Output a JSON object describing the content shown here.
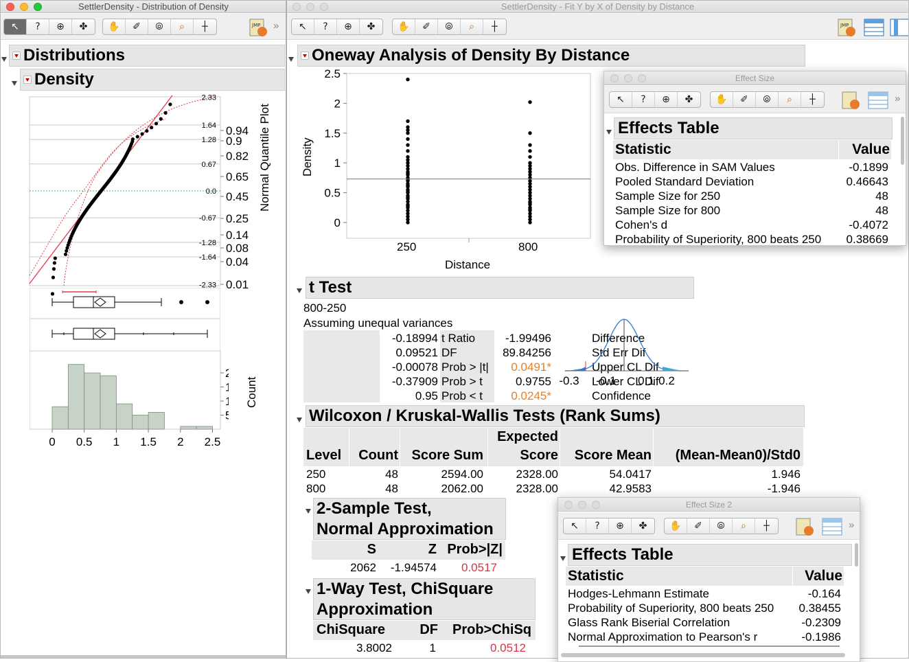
{
  "left_window": {
    "title": "SettlerDensity - Distribution of Density",
    "toolbar_icons": [
      "arrow-icon",
      "help-icon",
      "crosshair-icon",
      "move-icon",
      "hand-icon",
      "brush-icon",
      "lasso-icon",
      "magnifier-icon",
      "scale-icon"
    ],
    "distributions_title": "Distributions",
    "density_title": "Density",
    "quantile_axis_title": "Normal Quantile Plot",
    "quantile_ticks_z": [
      "2.33",
      "1.64",
      "1.28",
      "0.67",
      "0.0",
      "-0.67",
      "-1.28",
      "-1.64",
      "-2.33"
    ],
    "quantile_ticks_p": [
      "0.94",
      "0.9",
      "0.82",
      "0.65",
      "0.45",
      "0.25",
      "0.14",
      "0.08",
      "0.04",
      "0.01"
    ],
    "count_axis_title": "Count",
    "count_ticks": [
      "20",
      "15",
      "10",
      "5"
    ],
    "x_ticks": [
      "0",
      "0.5",
      "1",
      "1.5",
      "2",
      "2.5"
    ],
    "histogram_counts": [
      8,
      23,
      20,
      19,
      9,
      5,
      6,
      0,
      1,
      1
    ]
  },
  "right_window": {
    "title": "SettlerDensity - Fit Y by X of Density by Distance",
    "oneway_title": "Oneway Analysis of Density By Distance",
    "y_axis_label": "Density",
    "x_axis_label": "Distance",
    "y_ticks": [
      "2.5",
      "2",
      "1.5",
      "1",
      "0.5",
      "0"
    ],
    "x_ticks": [
      "250",
      "800"
    ],
    "grand_mean": 0.73
  },
  "ttest": {
    "title": "t Test",
    "comparison": "800-250",
    "assumption": "Assuming unequal variances",
    "rows": [
      {
        "label": "Difference",
        "value": "-0.18994",
        "stat": "t Ratio",
        "stat_value": "-1.99496",
        "highlight": false
      },
      {
        "label": "Std Err Dif",
        "value": "0.09521",
        "stat": "DF",
        "stat_value": "89.84256",
        "highlight": false
      },
      {
        "label": "Upper CL Dif",
        "value": "-0.00078",
        "stat": "Prob > |t|",
        "stat_value": "0.0491*",
        "highlight": true
      },
      {
        "label": "Lower CL Dif",
        "value": "-0.37909",
        "stat": "Prob > t",
        "stat_value": "0.9755",
        "highlight": false
      },
      {
        "label": "Confidence",
        "value": "0.95",
        "stat": "Prob < t",
        "stat_value": "0.0245*",
        "highlight": true
      }
    ],
    "dist_ticks": [
      "-0.3",
      "-0.1",
      "0.1",
      "0.2"
    ]
  },
  "wilcoxon": {
    "title": "Wilcoxon / Kruskal-Wallis Tests (Rank Sums)",
    "headers": {
      "level": "Level",
      "count": "Count",
      "score_sum": "Score Sum",
      "expected_1": "Expected",
      "expected_2": "Score",
      "score_mean": "Score Mean",
      "std0": "(Mean-Mean0)/Std0"
    },
    "rows": [
      {
        "level": "250",
        "count": "48",
        "score_sum": "2594.00",
        "expected": "2328.00",
        "score_mean": "54.0417",
        "std0": "1.946"
      },
      {
        "level": "800",
        "count": "48",
        "score_sum": "2062.00",
        "expected": "2328.00",
        "score_mean": "42.9583",
        "std0": "-1.946"
      }
    ]
  },
  "two_sample": {
    "title_1": "2-Sample Test,",
    "title_2": "Normal Approximation",
    "headers": {
      "s": "S",
      "z": "Z",
      "p": "Prob>|Z|"
    },
    "values": {
      "s": "2062",
      "z": "-1.94574",
      "p": "0.0517"
    }
  },
  "chisq": {
    "title_1": "1-Way Test, ChiSquare",
    "title_2": "Approximation",
    "headers": {
      "chi": "ChiSquare",
      "df": "DF",
      "p": "Prob>ChiSq"
    },
    "values": {
      "chi": "3.8002",
      "df": "1",
      "p": "0.0512"
    }
  },
  "effect_size": {
    "title": "Effect Size",
    "table_title": "Effects Table",
    "col_statistic": "Statistic",
    "col_value": "Value",
    "rows": [
      {
        "stat": "Obs. Difference in SAM Values",
        "value": "-0.1899"
      },
      {
        "stat": "Pooled Standard Deviation",
        "value": "0.46643"
      },
      {
        "stat": "Sample Size for 250",
        "value": "48"
      },
      {
        "stat": "Sample Size for 800",
        "value": "48"
      },
      {
        "stat": "Cohen's d",
        "value": "-0.4072"
      },
      {
        "stat": "Probability of Superiority, 800 beats 250",
        "value": "0.38669"
      }
    ]
  },
  "effect_size_2": {
    "title": "Effect Size 2",
    "table_title": "Effects Table",
    "col_statistic": "Statistic",
    "col_value": "Value",
    "rows": [
      {
        "stat": "Hodges-Lehmann Estimate",
        "value": "-0.164"
      },
      {
        "stat": "Probability of Superiority, 800 beats 250",
        "value": "0.38455"
      },
      {
        "stat": "Glass Rank Biserial Correlation",
        "value": "-0.2309"
      },
      {
        "stat": "Normal Approximation to Pearson's r",
        "value": "-0.1986"
      }
    ]
  },
  "colors": {
    "accent_orange": "#e8802a",
    "accent_red": "#e0303f",
    "hist_fill": "#c6d3c6",
    "normal_curve": "#2a7bd8",
    "quantile_red": "#e23a4a"
  }
}
